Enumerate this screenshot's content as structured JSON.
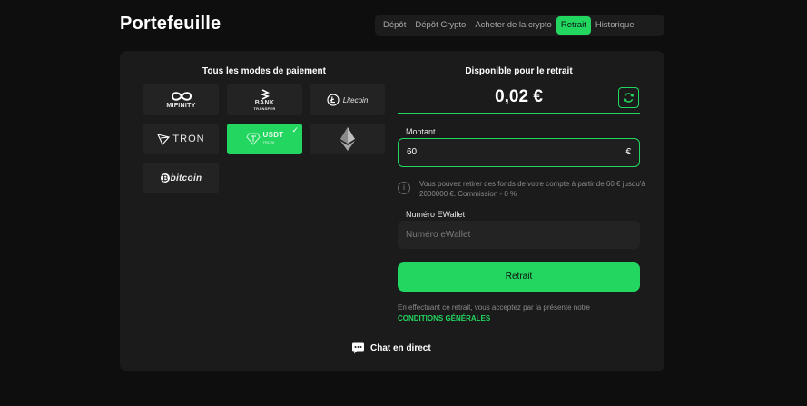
{
  "page": {
    "title": "Portefeuille"
  },
  "tabs": [
    {
      "label": "Dépôt",
      "active": false
    },
    {
      "label": "Dépôt Crypto",
      "active": false
    },
    {
      "label": "Acheter de la crypto",
      "active": false
    },
    {
      "label": "Retrait",
      "active": true
    },
    {
      "label": "Historique",
      "active": false
    }
  ],
  "payment_methods": {
    "heading": "Tous les modes de paiement",
    "items": [
      {
        "name": "MIFINITY",
        "icon": "infinity-icon",
        "selected": false
      },
      {
        "name": "BANK",
        "sub": "TRANSFER",
        "icon": "bank-transfer-icon",
        "selected": false
      },
      {
        "name": "Litecoin",
        "icon": "litecoin-icon",
        "selected": false
      },
      {
        "name": "TRON",
        "icon": "tron-icon",
        "selected": false
      },
      {
        "name": "USDT",
        "sub": "TRC20",
        "icon": "usdt-icon",
        "selected": true
      },
      {
        "name": "",
        "icon": "ethereum-icon",
        "selected": false
      },
      {
        "name": "bitcoin",
        "icon": "bitcoin-icon",
        "selected": false
      }
    ]
  },
  "withdraw": {
    "available_label": "Disponible pour le retrait",
    "balance": "0,02 €",
    "amount_label": "Montant",
    "amount_value": "60",
    "currency_symbol": "€",
    "info_text": "Vous pouvez retirer des fonds de votre compte à partir de 60 € jusqu'à 2000000 €. Commission - 0 %",
    "wallet_label": "Numéro EWallet",
    "wallet_placeholder": "Numéro eWallet",
    "submit_label": "Retrait",
    "terms_text": "En effectuant ce retrait, vous acceptez par la présente notre",
    "terms_link": "CONDITIONS GÉNÉRALES"
  },
  "chat": {
    "label": "Chat en direct"
  },
  "colors": {
    "accent": "#22d660",
    "background": "#0e0e0e",
    "panel": "#1b1b1b",
    "tile": "#232323"
  }
}
